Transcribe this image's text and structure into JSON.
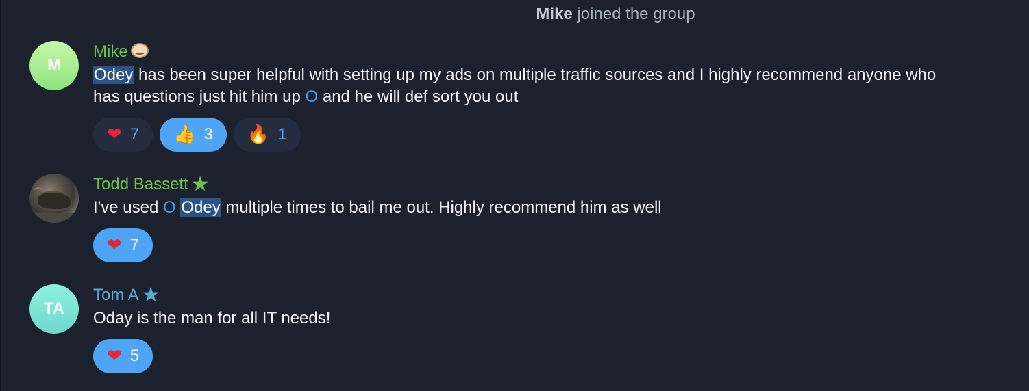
{
  "service_message": {
    "user": "Mike",
    "action": "joined the group"
  },
  "messages": [
    {
      "author": "Mike",
      "avatar_initials": "M",
      "text_parts": [
        "Odey",
        " has been super helpful with setting up my ads on multiple traffic sources and I highly recommend anyone who has questions just hit him up ",
        "O",
        " and he will def sort you out"
      ],
      "reactions": [
        {
          "emoji": "heart",
          "glyph": "❤",
          "count": "7",
          "selected": false
        },
        {
          "emoji": "thumbs-up",
          "glyph": "👍",
          "count": "3",
          "selected": true
        },
        {
          "emoji": "fire",
          "glyph": "🔥",
          "count": "1",
          "selected": false
        }
      ]
    },
    {
      "author": "Todd Bassett",
      "avatar_initials": "",
      "badge": "★",
      "text_parts": [
        "I've used ",
        "O",
        " ",
        "Odey",
        " multiple times to bail me out. Highly recommend him as well"
      ],
      "reactions": [
        {
          "emoji": "heart",
          "glyph": "❤",
          "count": "7",
          "selected": true
        }
      ]
    },
    {
      "author": "Tom A",
      "avatar_initials": "TA",
      "badge": "★",
      "text_parts": [
        "Oday is the man for all IT needs!"
      ],
      "reactions": [
        {
          "emoji": "heart",
          "glyph": "❤",
          "count": "5",
          "selected": true
        }
      ]
    }
  ],
  "colors": {
    "background": "#1c222d",
    "name_green": "#6cc24a",
    "name_blue": "#5aa8d6",
    "reaction_selected": "#4ea4f5",
    "reaction_unselected": "#232d3d",
    "highlight": "#2c5385"
  }
}
